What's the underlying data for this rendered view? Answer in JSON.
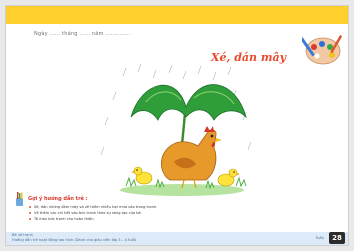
{
  "header": {
    "date_line": "Ngày ...... tháng ...... năm ..............",
    "title": "Xé, dán mây"
  },
  "guide": {
    "title": "Gợi ý hướng dẫn trẻ :",
    "items": [
      "Xé, dán những đám mây và vẽ thêm nhiều hạt mưa vào trong tranh.",
      "Vẽ thêm các chi tiết vào bức tranh theo sự sáng tạo của bé.",
      "Tô màu bức tranh cho hoàn thiện."
    ]
  },
  "footer": {
    "line1": "Bé vẽ tranh",
    "line2": "Hướng dẫn trẻ hoạt động tạo hình (Dành cho giáo viên lớp 3 – 4 tuổi)",
    "sub": "Tuần",
    "page_number": "28"
  },
  "colors": {
    "top_band": "#ffcf2e",
    "title": "#ea4a2c",
    "footer_band": "#ddeaf7"
  }
}
